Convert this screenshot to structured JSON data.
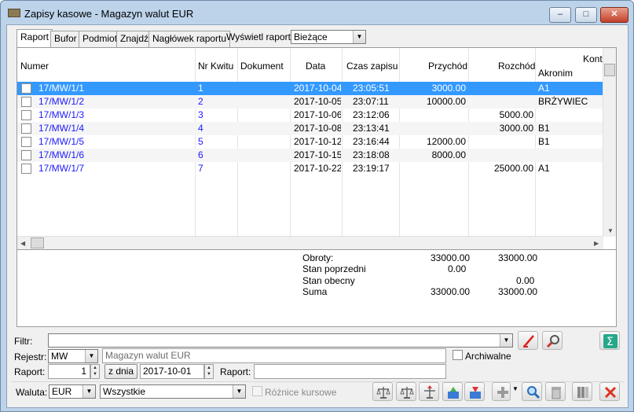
{
  "window": {
    "title": "Zapisy kasowe - Magazyn walut EUR",
    "min_label": "‒",
    "max_label": "□",
    "close_label": "✕"
  },
  "tabs": [
    "Raport",
    "Bufor",
    "Podmiot",
    "Znajdź",
    "Nagłówek raportu"
  ],
  "display_filter": {
    "label": "Wyświetl raporty",
    "value": "Bieżące"
  },
  "grid": {
    "columns": {
      "numer": "Numer",
      "nr_kwitu": "Nr Kwitu",
      "dokument": "Dokument",
      "data": "Data",
      "czas": "Czas zapisu",
      "przychod": "Przychód",
      "rozchod": "Rozchód",
      "kontrahent": "Kontr",
      "akronim": "Akronim"
    },
    "rows": [
      {
        "numer": "17/MW/1/1",
        "kwit": "1",
        "dokument": "",
        "data": "2017-10-04",
        "czas": "23:05:51",
        "przychod": "3000.00",
        "rozchod": "",
        "akronim": "A1"
      },
      {
        "numer": "17/MW/1/2",
        "kwit": "2",
        "dokument": "",
        "data": "2017-10-05",
        "czas": "23:07:11",
        "przychod": "10000.00",
        "rozchod": "",
        "akronim": "BRŻYWIEC"
      },
      {
        "numer": "17/MW/1/3",
        "kwit": "3",
        "dokument": "",
        "data": "2017-10-06",
        "czas": "23:12:06",
        "przychod": "",
        "rozchod": "5000.00",
        "akronim": ""
      },
      {
        "numer": "17/MW/1/4",
        "kwit": "4",
        "dokument": "",
        "data": "2017-10-08",
        "czas": "23:13:41",
        "przychod": "",
        "rozchod": "3000.00",
        "akronim": "B1"
      },
      {
        "numer": "17/MW/1/5",
        "kwit": "5",
        "dokument": "",
        "data": "2017-10-12",
        "czas": "23:16:44",
        "przychod": "12000.00",
        "rozchod": "",
        "akronim": "B1"
      },
      {
        "numer": "17/MW/1/6",
        "kwit": "6",
        "dokument": "",
        "data": "2017-10-15",
        "czas": "23:18:08",
        "przychod": "8000.00",
        "rozchod": "",
        "akronim": ""
      },
      {
        "numer": "17/MW/1/7",
        "kwit": "7",
        "dokument": "",
        "data": "2017-10-22",
        "czas": "23:19:17",
        "przychod": "",
        "rozchod": "25000.00",
        "akronim": "A1"
      }
    ]
  },
  "totals": {
    "obroty_label": "Obroty:",
    "obroty_przychod": "33000.00",
    "obroty_rozchod": "33000.00",
    "stan_poprzedni_label": "Stan poprzedni",
    "stan_poprzedni_value": "0.00",
    "stan_obecny_label": "Stan obecny",
    "stan_obecny_value": "0.00",
    "suma_label": "Suma",
    "suma_przychod": "33000.00",
    "suma_rozchod": "33000.00"
  },
  "filter": {
    "label": "Filtr:",
    "value": ""
  },
  "rejestr": {
    "label": "Rejestr:",
    "code": "MW",
    "name": "Magazyn walut EUR",
    "archiwalne_label": "Archiwalne"
  },
  "raport": {
    "label": "Raport:",
    "number": "1",
    "z_dnia_label": "z dnia",
    "date": "2017-10-01",
    "raport2_label": "Raport:",
    "raport2_value": ""
  },
  "waluta": {
    "label": "Waluta:",
    "value": "EUR",
    "type": "Wszystkie",
    "roznice_label": "Różnice kursowe"
  },
  "toolbar_icons": [
    "balance-icon",
    "balance-icon",
    "balance-export-icon",
    "export-icon",
    "import-icon",
    "add-icon",
    "search-icon",
    "delete-icon",
    "columns-icon",
    "close-icon"
  ]
}
